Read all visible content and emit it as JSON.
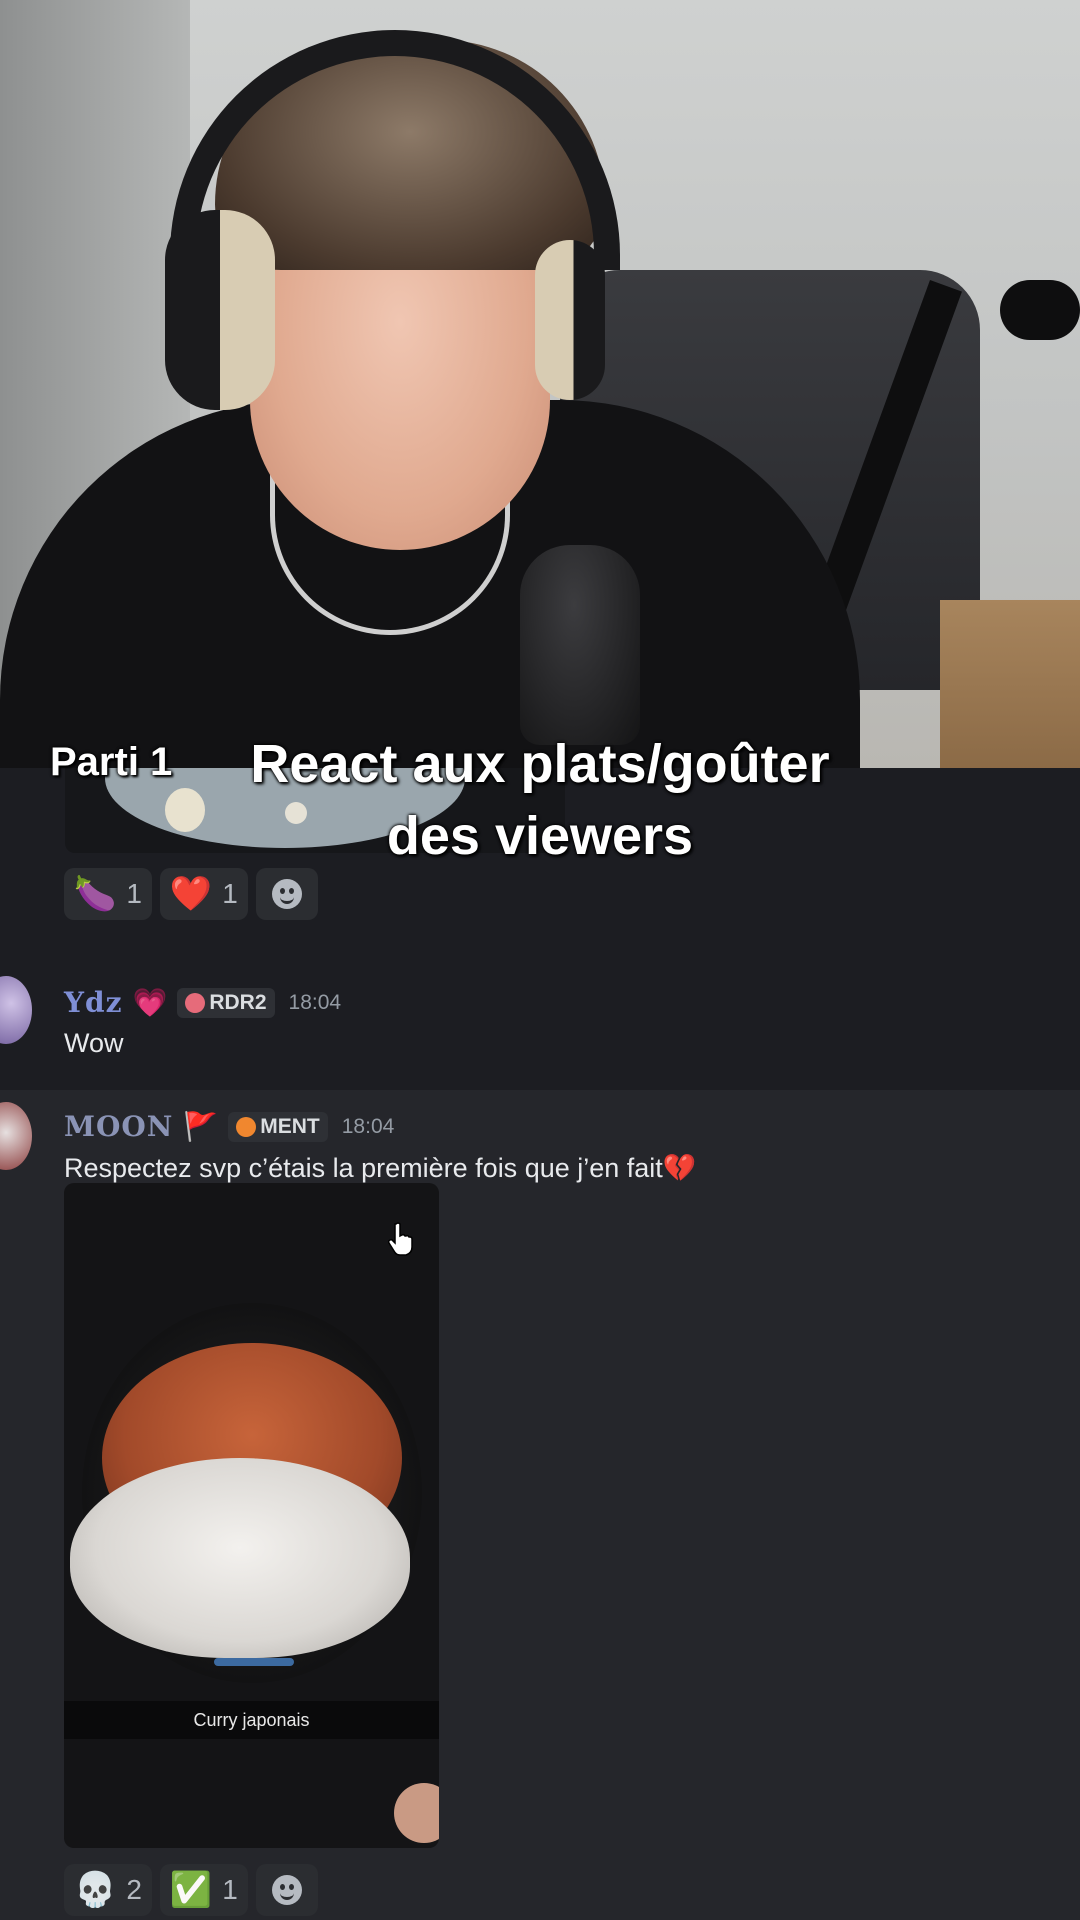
{
  "overlay": {
    "part_label": "Parti 1",
    "title_line1": "React aux plats/goûter",
    "title_line2": "des viewers"
  },
  "prev_message": {
    "reactions": [
      {
        "emoji": "🍆",
        "count": "1"
      },
      {
        "emoji": "❤️",
        "count": "1"
      }
    ],
    "add_reaction_icon": "smile-add-reaction-icon"
  },
  "messages": [
    {
      "username": "Ydz",
      "username_color": "#7f8fd6",
      "badge": "💗",
      "tag": "RDR2",
      "tag_icon_color": "#e66b7a",
      "time": "18:04",
      "text": "Wow"
    },
    {
      "username": "MOON",
      "username_color": "#8a93b5",
      "badge": "🚩",
      "tag": "MENT",
      "tag_icon_color": "#f0872f",
      "time": "18:04",
      "text": "Respectez svp c’étais la première fois que j’en fait💔",
      "attachment_caption": "Curry japonais",
      "reactions": [
        {
          "emoji": "💀",
          "count": "2"
        },
        {
          "emoji": "✅",
          "count": "1"
        }
      ]
    }
  ],
  "colors": {
    "chat_bg": "#1c1d22",
    "highlight_bg": "#25262b",
    "reaction_bg": "#2b2d31"
  }
}
